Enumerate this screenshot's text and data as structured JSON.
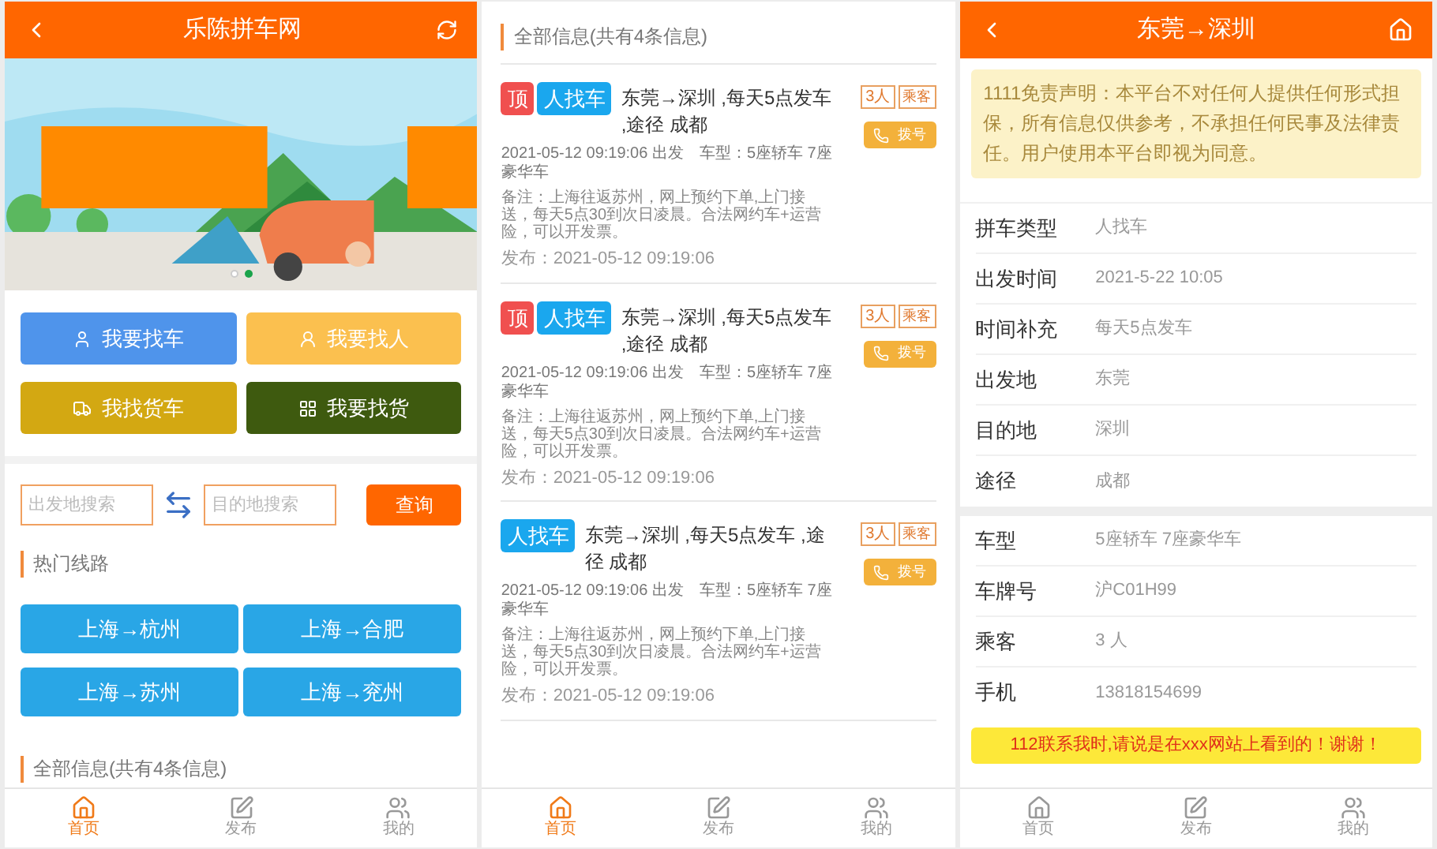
{
  "panels": [
    {
      "kind": "home",
      "header": {
        "title": "乐陈拼车网"
      },
      "banner": {
        "kind": "picture",
        "dots": [
          {
            "selected": false
          },
          {
            "selected": true
          }
        ]
      },
      "actions": [
        {
          "label": "我要找车",
          "color": "#4f94eb"
        },
        {
          "label": "我要找人",
          "color": "#fbc04f"
        },
        {
          "label": "我找货车",
          "color": "#d3a812"
        },
        {
          "label": "我要找货",
          "color": "#3e5a0f"
        }
      ],
      "search": {
        "from": {
          "placeholder": "出发地搜索"
        },
        "to": {
          "placeholder": "目的地搜索"
        },
        "button": "查询"
      },
      "hot_title": "热门线路",
      "routes": [
        "上海→杭州",
        "上海→合肥",
        "上海→苏州",
        "上海→兖州"
      ],
      "list_title": "全部信息(共有4条信息)",
      "tabbar": [
        {
          "label": "首页",
          "selected": true
        },
        {
          "label": "发布",
          "selected": false
        },
        {
          "label": "我的",
          "selected": false
        }
      ]
    },
    {
      "kind": "list",
      "list_title": "全部信息(共有4条信息)",
      "posts": [
        {
          "pinned": true,
          "pin": "顶",
          "tag": "人找车",
          "title": "东莞→深圳 ,每天5点发车 ,途径 成都",
          "seats": "3人",
          "role": "乘客",
          "call": "拨号",
          "depart": "2021-05-12 09:19:06 出发　车型：5座轿车 7座豪华车",
          "note": "备注：上海往返苏州，网上预约下单,上门接送，每天5点30到次日凌晨。合法网约车+运营险，可以开发票。",
          "published": "发布：2021-05-12 09:19:06"
        },
        {
          "pinned": true,
          "pin": "顶",
          "tag": "人找车",
          "title": "东莞→深圳 ,每天5点发车 ,途径 成都",
          "seats": "3人",
          "role": "乘客",
          "call": "拨号",
          "depart": "2021-05-12 09:19:06 出发　车型：5座轿车 7座豪华车",
          "note": "备注：上海往返苏州，网上预约下单,上门接送，每天5点30到次日凌晨。合法网约车+运营险，可以开发票。",
          "published": "发布：2021-05-12 09:19:06"
        },
        {
          "pinned": false,
          "tag": "人找车",
          "title": "东莞→深圳 ,每天5点发车 ,途径 成都",
          "seats": "3人",
          "role": "乘客",
          "call": "拨号",
          "depart": "2021-05-12 09:19:06 出发　车型：5座轿车 7座豪华车",
          "note": "备注：上海往返苏州，网上预约下单,上门接送，每天5点30到次日凌晨。合法网约车+运营险，可以开发票。",
          "published": "发布：2021-05-12 09:19:06"
        }
      ],
      "tabbar": [
        {
          "label": "首页",
          "selected": true
        },
        {
          "label": "发布",
          "selected": false
        },
        {
          "label": "我的",
          "selected": false
        }
      ]
    },
    {
      "kind": "detail",
      "header": {
        "title": "东莞→深圳"
      },
      "notice": "1111免责声明：本平台不对任何人提供任何形式担保，所有信息仅供参考，不承担任何民事及法律责任。用户使用本平台即视为同意。",
      "groups": [
        [
          {
            "label": "拼车类型",
            "value": "人找车"
          },
          {
            "label": "出发时间",
            "value": "2021-5-22 10:05"
          },
          {
            "label": "时间补充",
            "value": "每天5点发车"
          },
          {
            "label": "出发地",
            "value": "东莞"
          },
          {
            "label": "目的地",
            "value": "深圳"
          },
          {
            "label": "途径",
            "value": "成都"
          }
        ],
        [
          {
            "label": "车型",
            "value": "5座轿车 7座豪华车"
          },
          {
            "label": "车牌号",
            "value": "沪C01H99"
          },
          {
            "label": "乘客",
            "value": "3 人"
          },
          {
            "label": "手机",
            "value": "13818154699"
          }
        ]
      ],
      "contact": "112联系我时,请说是在xxx网站上看到的！谢谢！",
      "tabbar": [
        {
          "label": "首页",
          "selected": false
        },
        {
          "label": "发布",
          "selected": false
        },
        {
          "label": "我的",
          "selected": false
        }
      ]
    }
  ]
}
